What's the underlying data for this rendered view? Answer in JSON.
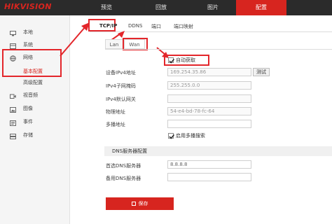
{
  "brand": {
    "logo": "HIKVISION",
    "accent": "#d7251f"
  },
  "top_nav": [
    {
      "label": "预览"
    },
    {
      "label": "回放"
    },
    {
      "label": "图片"
    },
    {
      "label": "配置"
    }
  ],
  "sidebar": {
    "items": [
      {
        "label": "本地",
        "icon": "monitor-icon"
      },
      {
        "label": "系统",
        "icon": "system-icon"
      },
      {
        "label": "网络",
        "icon": "globe-icon"
      },
      {
        "label": "视音频",
        "icon": "video-icon"
      },
      {
        "label": "图像",
        "icon": "image-icon"
      },
      {
        "label": "事件",
        "icon": "event-icon"
      },
      {
        "label": "存储",
        "icon": "storage-icon"
      }
    ],
    "network_sub": [
      {
        "label": "基本配置",
        "active": true
      },
      {
        "label": "高级配置",
        "active": false
      }
    ]
  },
  "sub_tabs": [
    "TCP/IP",
    "DDNS",
    "端口",
    "端口映射"
  ],
  "inner_tabs": [
    "Lan",
    "Wan"
  ],
  "form": {
    "auto_get_label": "自动获取",
    "auto_get_checked": true,
    "ipv4_label": "设备IPv4地址",
    "ipv4_value": "169.254.35.86",
    "test_button": "测试",
    "mask_label": "IPv4子网掩码",
    "mask_value": "255.255.0.0",
    "gateway_label": "IPv4默认网关",
    "gateway_value": "",
    "mac_label": "物理地址",
    "mac_value": "54-e4-bd-78-fc-64",
    "multicast_label": "多播地址",
    "multicast_value": "",
    "multicast_search_label": "启用多播搜索",
    "multicast_search_checked": true,
    "dns_section": "DNS服务器配置",
    "dns1_label": "首选DNS服务器",
    "dns1_value": "8.8.8.8",
    "dns2_label": "备用DNS服务器",
    "dns2_value": ""
  },
  "save_button": "保存"
}
